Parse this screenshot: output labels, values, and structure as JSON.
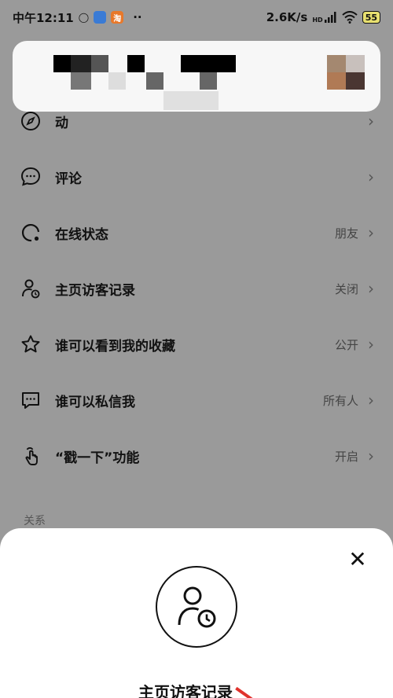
{
  "status_bar": {
    "time": "中午12:11",
    "app_badge_label": "淘",
    "more": "··",
    "speed": "2.6K/s",
    "network": "HD",
    "battery": "55"
  },
  "settings": {
    "items": [
      {
        "label": "动",
        "value": "",
        "icon": "compass-icon"
      },
      {
        "label": "评论",
        "value": "",
        "icon": "comment-icon"
      },
      {
        "label": "在线状态",
        "value": "朋友",
        "icon": "online-status-icon"
      },
      {
        "label": "主页访客记录",
        "value": "关闭",
        "icon": "visitor-record-icon"
      },
      {
        "label": "谁可以看到我的收藏",
        "value": "公开",
        "icon": "star-icon"
      },
      {
        "label": "谁可以私信我",
        "value": "所有人",
        "icon": "message-icon"
      },
      {
        "label": "“戳一下”功能",
        "value": "开启",
        "icon": "poke-hand-icon"
      }
    ],
    "section_title": "关系"
  },
  "sheet": {
    "close": "✕",
    "title": "主页访客记录",
    "emblem_icon": "visitor-record-icon"
  },
  "colors": {
    "overlay": "#9a9a9a",
    "accent": "#e0322c"
  }
}
